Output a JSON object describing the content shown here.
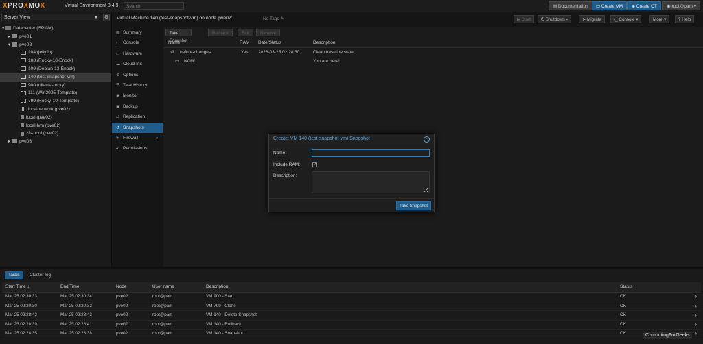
{
  "topbar": {
    "logo_pre": "PRO",
    "logo_x": "X",
    "logo_post": "MO",
    "logo_x2": "X",
    "version": "Virtual Environment 8.4.9",
    "search_placeholder": "Search",
    "documentation": "Documentation",
    "create_vm": "Create VM",
    "create_ct": "Create CT",
    "user": "root@pam"
  },
  "sidebar": {
    "view": "Server View",
    "items": [
      {
        "label": "Datacenter (SPINX)"
      },
      {
        "label": "pve01"
      },
      {
        "label": "pve02"
      },
      {
        "label": "104 (jellyfin)"
      },
      {
        "label": "108 (Rocky-10-Enock)"
      },
      {
        "label": "109 (Debian-13-Enock)"
      },
      {
        "label": "140 (test-snapshot-vm)"
      },
      {
        "label": "900 (ollama-rocky)"
      },
      {
        "label": "111 (Win2025-Template)"
      },
      {
        "label": "799 (Rocky-10-Template)"
      },
      {
        "label": "localnetwork (pve02)"
      },
      {
        "label": "local (pve02)"
      },
      {
        "label": "local-lvm (pve02)"
      },
      {
        "label": "zfs-pool (pve02)"
      },
      {
        "label": "pve03"
      }
    ]
  },
  "vmheader": {
    "title": "Virtual Machine 140 (test-snapshot-vm) on node 'pve02'",
    "no_tags": "No Tags",
    "start": "Start",
    "shutdown": "Shutdown",
    "migrate": "Migrate",
    "console": "Console",
    "more": "More",
    "help": "Help"
  },
  "vmnav": {
    "items": [
      {
        "label": "Summary"
      },
      {
        "label": "Console"
      },
      {
        "label": "Hardware"
      },
      {
        "label": "Cloud-Init"
      },
      {
        "label": "Options"
      },
      {
        "label": "Task History"
      },
      {
        "label": "Monitor"
      },
      {
        "label": "Backup"
      },
      {
        "label": "Replication"
      },
      {
        "label": "Snapshots"
      },
      {
        "label": "Firewall"
      },
      {
        "label": "Permissions"
      }
    ]
  },
  "snapshots": {
    "toolbar": {
      "take": "Take Snapshot",
      "rollback": "Rollback",
      "edit": "Edit",
      "remove": "Remove"
    },
    "columns": {
      "name": "Name",
      "ram": "RAM",
      "date": "Date/Status",
      "description": "Description"
    },
    "rows": [
      {
        "name": "before-changes",
        "ram": "Yes",
        "date": "2026-03-25 02:28:30",
        "description": "Clean baseline state"
      },
      {
        "name": "NOW",
        "ram": "",
        "date": "",
        "description": "You are here!"
      }
    ]
  },
  "dialog": {
    "title": "Create: VM 140 (test-snapshot-vm) Snapshot",
    "name_label": "Name:",
    "name_value": "",
    "ram_label": "Include RAM:",
    "ram_checked": true,
    "desc_label": "Description:",
    "desc_value": "",
    "submit": "Take Snapshot"
  },
  "bottom": {
    "tabs": [
      {
        "label": "Tasks"
      },
      {
        "label": "Cluster log"
      }
    ],
    "columns": {
      "start": "Start Time",
      "end": "End Time",
      "node": "Node",
      "user": "User name",
      "description": "Description",
      "status": "Status"
    },
    "rows": [
      {
        "start": "Mar 25 02:30:33",
        "end": "Mar 25 02:30:34",
        "node": "pve02",
        "user": "root@pam",
        "description": "VM 900 - Start",
        "status": "OK"
      },
      {
        "start": "Mar 25 02:30:30",
        "end": "Mar 25 02:30:32",
        "node": "pve02",
        "user": "root@pam",
        "description": "VM 799 - Clone",
        "status": "OK"
      },
      {
        "start": "Mar 25 02:28:42",
        "end": "Mar 25 02:28:43",
        "node": "pve02",
        "user": "root@pam",
        "description": "VM 140 - Delete Snapshot",
        "status": "OK"
      },
      {
        "start": "Mar 25 02:28:39",
        "end": "Mar 25 02:28:41",
        "node": "pve02",
        "user": "root@pam",
        "description": "VM 140 - Rollback",
        "status": "OK"
      },
      {
        "start": "Mar 25 02:28:35",
        "end": "Mar 25 02:28:38",
        "node": "pve02",
        "user": "root@pam",
        "description": "VM 140 - Snapshot",
        "status": "OK"
      }
    ]
  },
  "watermark": "ComputingForGeeks",
  "colors": {
    "accent": "#1f5d8c",
    "brand": "#e57000",
    "dialog_title": "#5ea4d6"
  }
}
